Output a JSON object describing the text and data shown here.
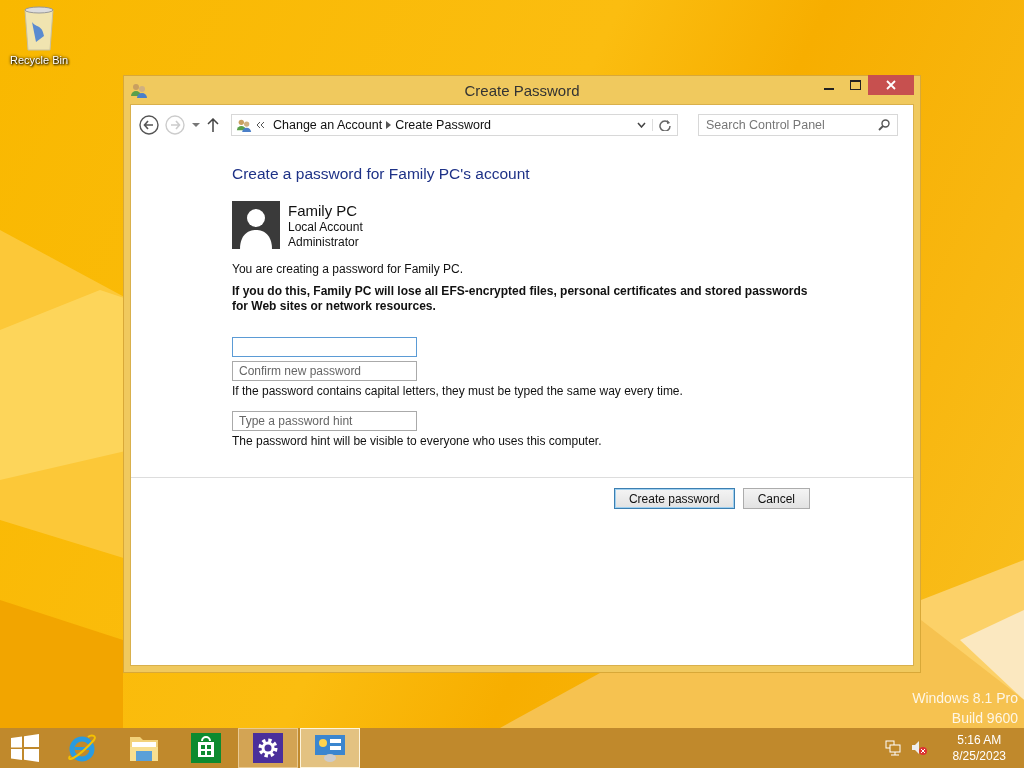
{
  "desktop": {
    "icons": [
      {
        "label": "Recycle Bin"
      }
    ],
    "watermark": [
      "Windows 8.1 Pro",
      "Build 9600"
    ]
  },
  "window": {
    "title": "Create Password",
    "breadcrumb": [
      "Change an Account",
      "Create Password"
    ],
    "search": {
      "placeholder": "Search Control Panel"
    },
    "heading": "Create a password for Family PC's account",
    "account": {
      "name": "Family PC",
      "type": "Local Account",
      "role": "Administrator"
    },
    "intro": "You are creating a password for Family PC.",
    "warning": "If you do this, Family PC will lose all EFS-encrypted files, personal certificates and stored passwords for Web sites or network resources.",
    "fields": [
      {
        "focused": true
      },
      {
        "placeholder": "Confirm new password",
        "focused": false,
        "note": "If the password contains capital letters, they must be typed the same way every time."
      },
      {
        "placeholder": "Type a password hint",
        "focused": false,
        "note": "The password hint will be visible to everyone who uses this computer."
      }
    ],
    "buttons": [
      {
        "label": "Create password",
        "default": true
      },
      {
        "label": "Cancel",
        "default": false
      }
    ]
  },
  "taskbar": {
    "apps": [
      {
        "kind": "ie",
        "running": false,
        "selected": false
      },
      {
        "kind": "explorer",
        "running": false,
        "selected": false
      },
      {
        "kind": "store",
        "running": false,
        "selected": false
      },
      {
        "kind": "settings",
        "running": true,
        "selected": false
      },
      {
        "kind": "control-panel",
        "running": true,
        "selected": true
      }
    ],
    "clock": {
      "time": "5:16 AM",
      "date": "8/25/2023"
    }
  }
}
